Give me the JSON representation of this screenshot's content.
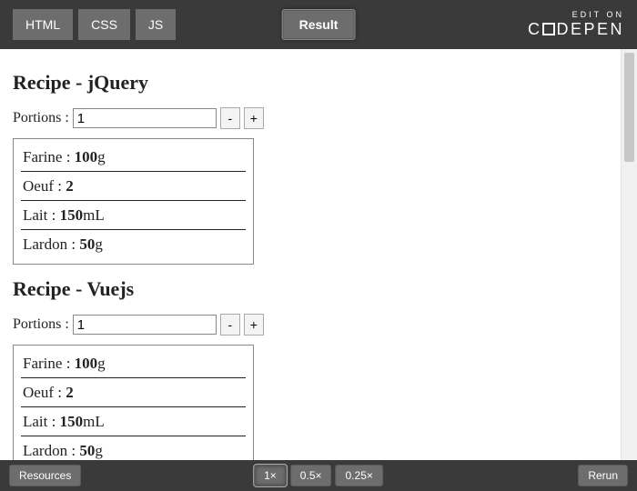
{
  "topbar": {
    "tabs": {
      "html": "HTML",
      "css": "CSS",
      "js": "JS"
    },
    "result": "Result",
    "codepen": {
      "edit": "EDIT ON",
      "brand_pre": "C",
      "brand_mid": "DEPEN"
    }
  },
  "recipes": {
    "jquery": {
      "title": "Recipe - jQuery",
      "portions_label": "Portions :",
      "portions_value": "1",
      "minus": "-",
      "plus": "+",
      "items": [
        {
          "name": "Farine",
          "qty": "100",
          "unit": "g"
        },
        {
          "name": "Oeuf",
          "qty": "2",
          "unit": ""
        },
        {
          "name": "Lait",
          "qty": "150",
          "unit": "mL"
        },
        {
          "name": "Lardon",
          "qty": "50",
          "unit": "g"
        }
      ]
    },
    "vuejs": {
      "title": "Recipe - Vuejs",
      "portions_label": "Portions :",
      "portions_value": "1",
      "minus": "-",
      "plus": "+",
      "items": [
        {
          "name": "Farine",
          "qty": "100",
          "unit": "g"
        },
        {
          "name": "Oeuf",
          "qty": "2",
          "unit": ""
        },
        {
          "name": "Lait",
          "qty": "150",
          "unit": "mL"
        },
        {
          "name": "Lardon",
          "qty": "50",
          "unit": "g"
        }
      ]
    }
  },
  "bottombar": {
    "resources": "Resources",
    "zoom": {
      "x1": "1×",
      "x05": "0.5×",
      "x025": "0.25×"
    },
    "rerun": "Rerun"
  }
}
